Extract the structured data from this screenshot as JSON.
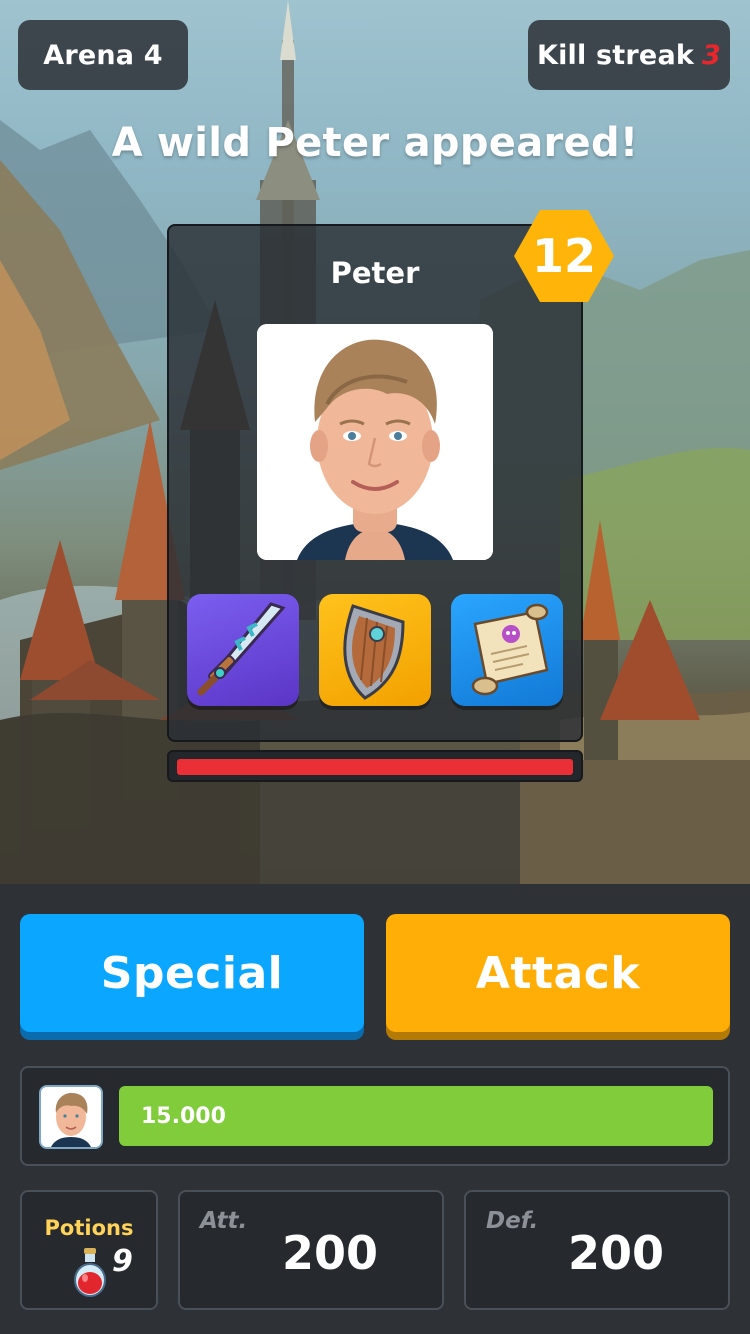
{
  "header": {
    "arena_label": "Arena 4",
    "kill_streak_label": "Kill streak",
    "kill_streak_value": "3"
  },
  "encounter": {
    "headline": "A wild Peter appeared!"
  },
  "enemy": {
    "name": "Peter",
    "level": "12",
    "health_fraction": 1.0,
    "items": [
      {
        "icon": "sword-icon"
      },
      {
        "icon": "shield-icon"
      },
      {
        "icon": "scroll-icon"
      }
    ]
  },
  "actions": {
    "special_label": "Special",
    "attack_label": "Attack"
  },
  "player": {
    "health_label": "15.000",
    "health_fraction": 1.0
  },
  "stats": {
    "potions_label": "Potions",
    "potions_count": "9",
    "attack_label": "Att.",
    "attack_value": "200",
    "defense_label": "Def.",
    "defense_value": "200"
  },
  "colors": {
    "special": "#0ba6ff",
    "attack": "#ffad07",
    "enemy_hp": "#ea2f36",
    "player_hp": "#81cc3a",
    "level_badge": "#ffb40a",
    "streak": "#e8262b"
  }
}
